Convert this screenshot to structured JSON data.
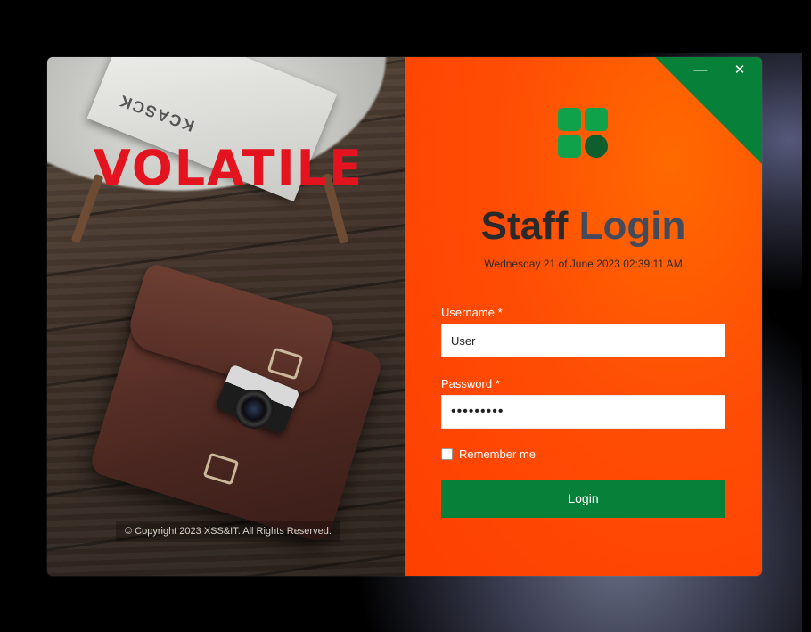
{
  "brand": {
    "name": "VOLATILE",
    "color": "#e3141f"
  },
  "photo": {
    "magazine_text": "KCASCK"
  },
  "footer": {
    "copyright": "© Copyright 2023 XSS&IT. All Rights Reserved."
  },
  "window_controls": {
    "minimize": "—",
    "close": "✕"
  },
  "login": {
    "title_part1": "Staff",
    "title_part2": "Login",
    "datetime": "Wednesday 21 of June 2023 02:39:11 AM",
    "username_label": "Username *",
    "username_value": "User",
    "password_label": "Password *",
    "password_value": "•••••••••",
    "remember_label": "Remember me",
    "login_button": "Login"
  },
  "colors": {
    "panel_orange": "#ff4d05",
    "accent_green": "#07813a",
    "logo_green": "#10a24a",
    "logo_dark_green": "#0e5e2e"
  },
  "icons": {
    "logo": "four-tile-logo-icon",
    "minimize": "minimize-icon",
    "close": "close-icon"
  }
}
